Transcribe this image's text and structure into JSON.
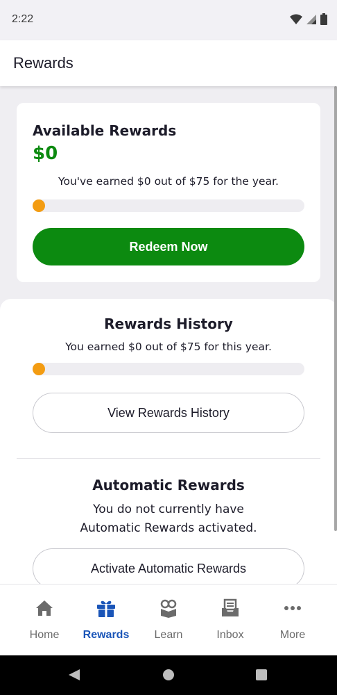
{
  "status_bar": {
    "time": "2:22"
  },
  "header": {
    "title": "Rewards"
  },
  "available": {
    "title": "Available Rewards",
    "amount": "$0",
    "earned_text": "You've earned $0 out of $75 for the year.",
    "progress_earned": 0,
    "progress_goal": 75,
    "button_label": "Redeem Now"
  },
  "history": {
    "title": "Rewards History",
    "earned_text": "You earned $0 out of $75 for this year.",
    "progress_earned": 0,
    "progress_goal": 75,
    "button_label": "View Rewards History"
  },
  "automatic": {
    "title": "Automatic Rewards",
    "description": "You do not currently have Automatic Rewards activated.",
    "button_label": "Activate Automatic Rewards"
  },
  "bottom_nav": {
    "items": [
      {
        "label": "Home",
        "icon": "home-icon",
        "active": false
      },
      {
        "label": "Rewards",
        "icon": "gift-icon",
        "active": true
      },
      {
        "label": "Learn",
        "icon": "learn-icon",
        "active": false
      },
      {
        "label": "Inbox",
        "icon": "inbox-icon",
        "active": false
      },
      {
        "label": "More",
        "icon": "more-icon",
        "active": false
      }
    ]
  },
  "colors": {
    "accent_green": "#0c8a10",
    "progress_orange": "#f39c12",
    "active_nav_blue": "#1a55b8"
  }
}
